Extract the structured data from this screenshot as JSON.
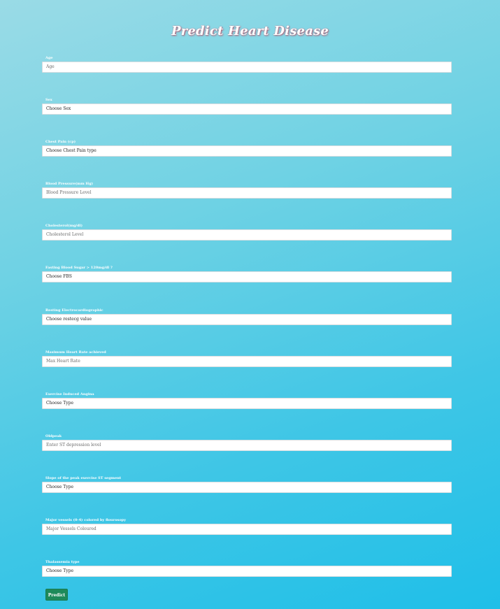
{
  "page": {
    "title": "Predict Heart Disease"
  },
  "form": {
    "fields": [
      {
        "label": "Age",
        "value": "Age",
        "kind": "input"
      },
      {
        "label": "Sex",
        "value": "Choose Sex",
        "kind": "select"
      },
      {
        "label": "Chest Pain (cp)",
        "value": "Choose Chest Pain type",
        "kind": "select"
      },
      {
        "label": "Blood Pressure(mm Hg)",
        "value": "Blood Pressure Level",
        "kind": "input"
      },
      {
        "label": "Cholesterol(mg/dl)",
        "value": "Cholesterol Level",
        "kind": "input"
      },
      {
        "label": "Fasting Blood Sugar > 120mg/dl ?",
        "value": "Choose FBS",
        "kind": "select"
      },
      {
        "label": "Resting Electrocardiographic",
        "value": "Choose restecg value",
        "kind": "select"
      },
      {
        "label": "Maximum Heart Rate achieved",
        "value": "Max Heart Rate",
        "kind": "input"
      },
      {
        "label": "Exercise Induced Angina",
        "value": "Choose Type",
        "kind": "select"
      },
      {
        "label": "Oldpeak",
        "value": "Enter ST depression level",
        "kind": "input"
      },
      {
        "label": "Slope of the peak exercise ST segment",
        "value": "Choose Type",
        "kind": "select"
      },
      {
        "label": "Major vessels (0-4) colored by flourosopy",
        "value": "Major Vessels Coloured",
        "kind": "input"
      },
      {
        "label": "Thalassemia type",
        "value": "Choose Type",
        "kind": "select"
      }
    ],
    "submit_label": "Predict"
  },
  "colors": {
    "button": "#1e8a5a",
    "title_shadow": "#b5546b"
  }
}
